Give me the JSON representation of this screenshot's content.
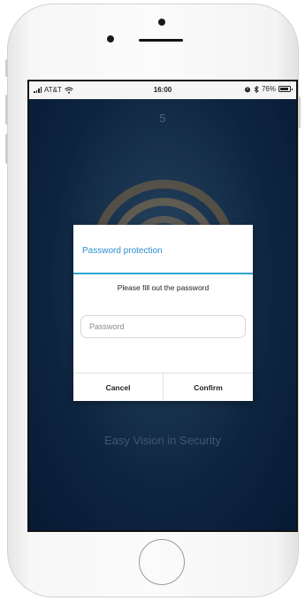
{
  "status_bar": {
    "carrier": "AT&T",
    "time": "16:00",
    "battery": "76%",
    "signal_icon": "signal-bars-icon",
    "wifi_icon": "wifi-icon",
    "alarm_icon": "alarm-icon",
    "bluetooth_icon": "bluetooth-icon",
    "battery_icon": "battery-icon"
  },
  "app": {
    "top_number": "5",
    "tagline": "Easy Vision in Security",
    "logo_icon": "concentric-rings-logo"
  },
  "dialog": {
    "title": "Password protection",
    "message": "Please fill out the password",
    "password_placeholder": "Password",
    "cancel_label": "Cancel",
    "confirm_label": "Confirm"
  },
  "colors": {
    "accent": "#2a8fd1",
    "app_background": "#123155"
  }
}
